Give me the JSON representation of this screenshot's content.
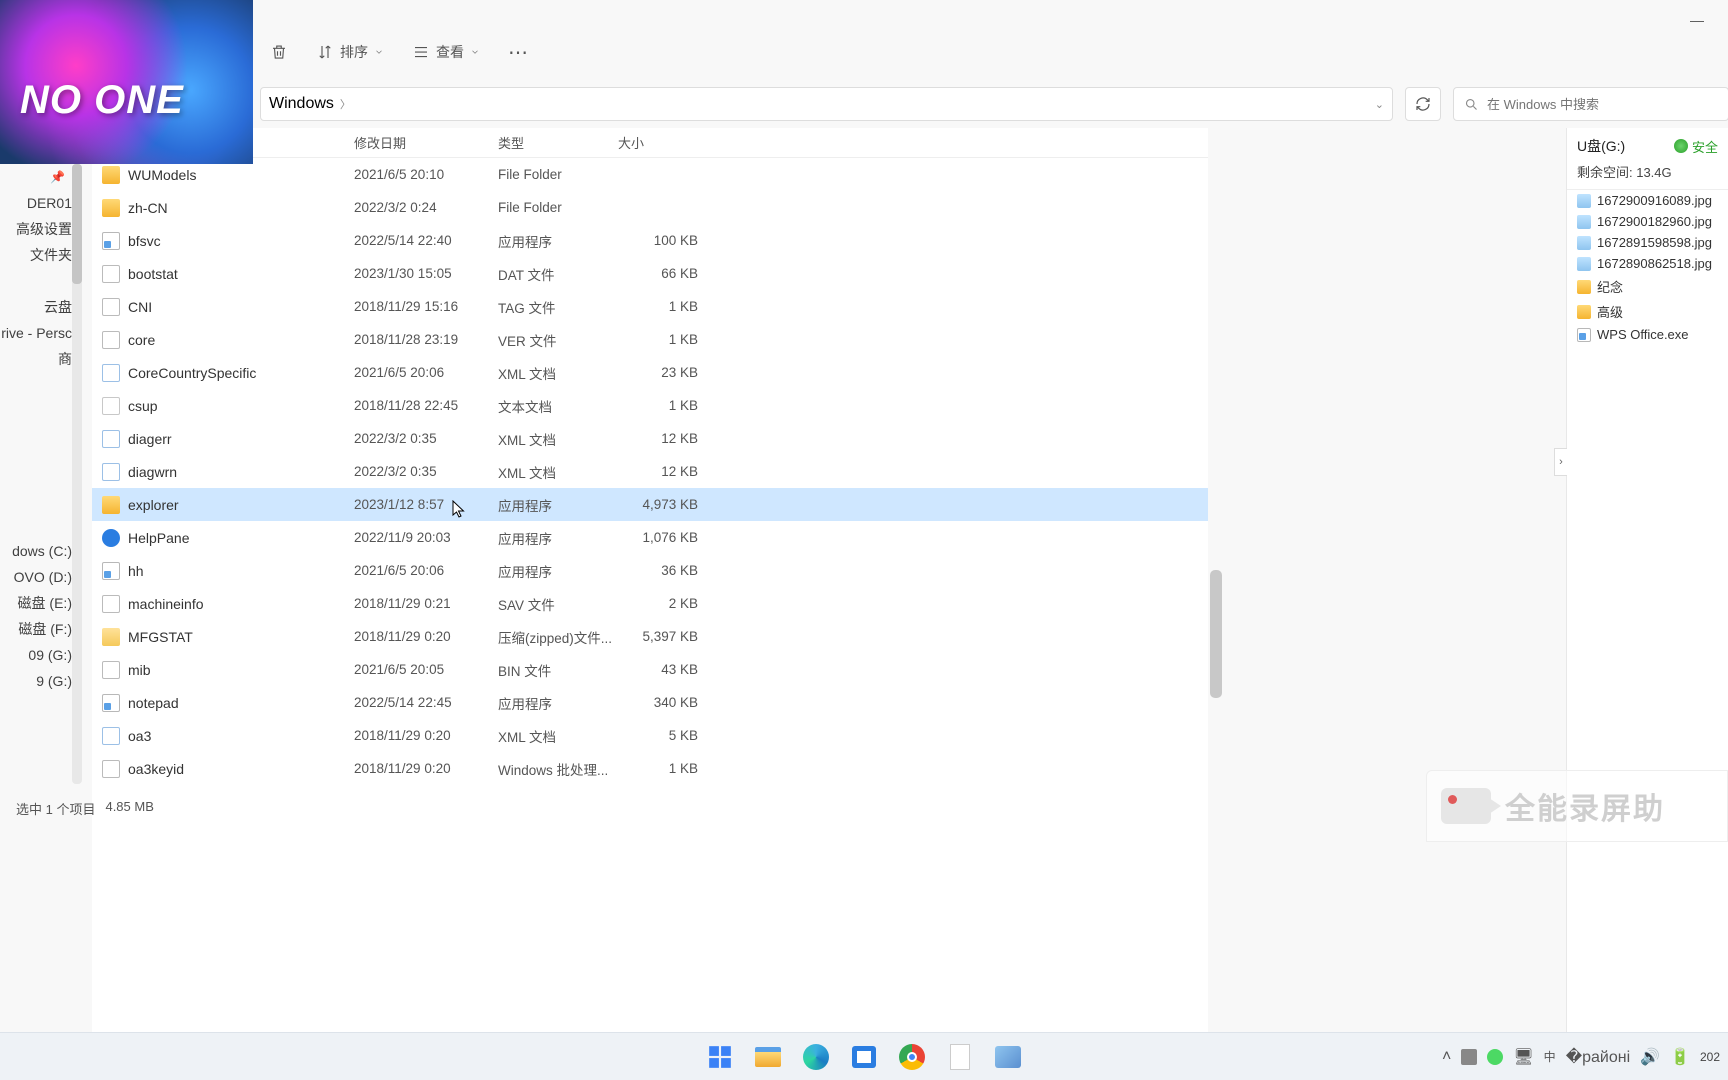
{
  "window": {
    "minimize": "—",
    "maximize": "▢",
    "close": "✕"
  },
  "toolbar": {
    "delete": "",
    "sort_label": "排序",
    "view_label": "查看",
    "more": "⋯"
  },
  "breadcrumb": {
    "segment": "Windows"
  },
  "search": {
    "placeholder": "在 Windows 中搜索"
  },
  "leftnav": {
    "items": [
      "DER01",
      "高级设置",
      "文件夹",
      "",
      "云盘",
      "rive - Persc",
      "商",
      "",
      "dows (C:)",
      "OVO (D:)",
      "磁盘 (E:)",
      "磁盘 (F:)",
      "09 (G:)",
      "9 (G:)"
    ],
    "pin": "📌"
  },
  "columns": {
    "name": "",
    "date": "修改日期",
    "type": "类型",
    "size": "大小"
  },
  "files": [
    {
      "icon": "folder",
      "name": "WUModels",
      "date": "2021/6/5 20:10",
      "type": "File Folder",
      "size": ""
    },
    {
      "icon": "folder",
      "name": "zh-CN",
      "date": "2022/3/2 0:24",
      "type": "File Folder",
      "size": ""
    },
    {
      "icon": "exe",
      "name": "bfsvc",
      "date": "2022/5/14 22:40",
      "type": "应用程序",
      "size": "100 KB"
    },
    {
      "icon": "file",
      "name": "bootstat",
      "date": "2023/1/30 15:05",
      "type": "DAT 文件",
      "size": "66 KB"
    },
    {
      "icon": "file",
      "name": "CNI",
      "date": "2018/11/29 15:16",
      "type": "TAG 文件",
      "size": "1 KB"
    },
    {
      "icon": "file",
      "name": "core",
      "date": "2018/11/28 23:19",
      "type": "VER 文件",
      "size": "1 KB"
    },
    {
      "icon": "xml",
      "name": "CoreCountrySpecific",
      "date": "2021/6/5 20:06",
      "type": "XML 文档",
      "size": "23 KB"
    },
    {
      "icon": "txt",
      "name": "csup",
      "date": "2018/11/28 22:45",
      "type": "文本文档",
      "size": "1 KB"
    },
    {
      "icon": "xml",
      "name": "diagerr",
      "date": "2022/3/2 0:35",
      "type": "XML 文档",
      "size": "12 KB"
    },
    {
      "icon": "xml",
      "name": "diagwrn",
      "date": "2022/3/2 0:35",
      "type": "XML 文档",
      "size": "12 KB"
    },
    {
      "icon": "folder",
      "name": "explorer",
      "date": "2023/1/12 8:57",
      "type": "应用程序",
      "size": "4,973 KB",
      "selected": true
    },
    {
      "icon": "help",
      "name": "HelpPane",
      "date": "2022/11/9 20:03",
      "type": "应用程序",
      "size": "1,076 KB"
    },
    {
      "icon": "exe",
      "name": "hh",
      "date": "2021/6/5 20:06",
      "type": "应用程序",
      "size": "36 KB"
    },
    {
      "icon": "file",
      "name": "machineinfo",
      "date": "2018/11/29 0:21",
      "type": "SAV 文件",
      "size": "2 KB"
    },
    {
      "icon": "zip",
      "name": "MFGSTAT",
      "date": "2018/11/29 0:20",
      "type": "压缩(zipped)文件...",
      "size": "5,397 KB"
    },
    {
      "icon": "file",
      "name": "mib",
      "date": "2021/6/5 20:05",
      "type": "BIN 文件",
      "size": "43 KB"
    },
    {
      "icon": "exe",
      "name": "notepad",
      "date": "2022/5/14 22:45",
      "type": "应用程序",
      "size": "340 KB"
    },
    {
      "icon": "xml",
      "name": "oa3",
      "date": "2018/11/29 0:20",
      "type": "XML 文档",
      "size": "5 KB"
    },
    {
      "icon": "file",
      "name": "oa3keyid",
      "date": "2018/11/29 0:20",
      "type": "Windows 批处理...",
      "size": "1 KB"
    }
  ],
  "status": {
    "selected": "选中 1 个项目",
    "size": "4.85 MB"
  },
  "rpanel": {
    "title": "U盘(G:)",
    "badge": "安全",
    "free": "剩余空间: 13.4G",
    "items": [
      {
        "icon": "img",
        "label": "1672900916089.jpg"
      },
      {
        "icon": "img",
        "label": "1672900182960.jpg"
      },
      {
        "icon": "img",
        "label": "1672891598598.jpg"
      },
      {
        "icon": "img",
        "label": "1672890862518.jpg"
      },
      {
        "icon": "folder",
        "label": "纪念"
      },
      {
        "icon": "folder",
        "label": "高级"
      },
      {
        "icon": "exe",
        "label": "WPS Office.exe"
      }
    ]
  },
  "watermark": "全能录屏助",
  "taskbar": {
    "time": "202"
  }
}
